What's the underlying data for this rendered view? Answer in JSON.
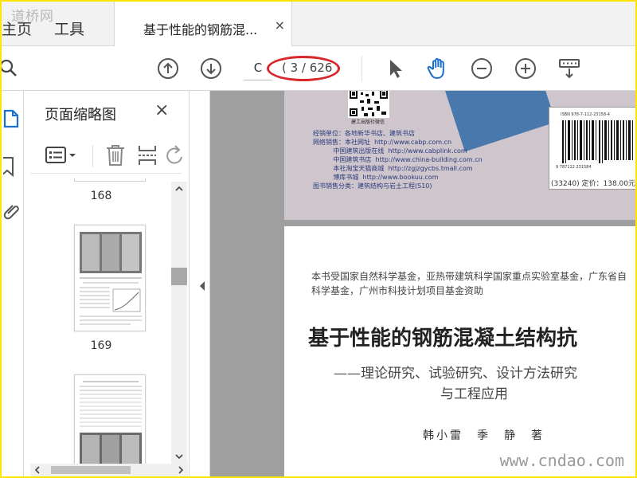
{
  "watermark_top": "道桥网",
  "watermark_bottom": "www.cndao.com",
  "tabs": {
    "home": "主页",
    "tools": "工具",
    "document": "基于性能的钢筋混...",
    "close": "×"
  },
  "toolbar": {
    "page_input": "C",
    "page_count": "( 3 / 626"
  },
  "panel": {
    "title": "页面缩略图",
    "close": "×",
    "thumbnails": [
      {
        "page": "168"
      },
      {
        "page": "169"
      }
    ]
  },
  "document": {
    "cover": {
      "qr_label": "建工出版社微信",
      "info_lines": [
        "经销单位：各地新华书店、建筑书店",
        "网络销售：本社网址  http://www.cabp.com.cn",
        "          中国建筑出版在线  http://www.cabplink.com",
        "          中国建筑书店  http://www.china-building.com.cn",
        "          本社淘宝天猫商城  http://zgjzgycbs.tmall.com",
        "          博库书城  http://www.bookuu.com",
        "图书销售分类：建筑结构与岩土工程(S10)"
      ],
      "isbn": "ISBN 978-7-112-23158-4",
      "isbn_digits": "9 787112 231584",
      "price": "(33240)  定价：138.00元"
    },
    "title_page": {
      "funding_line1": "本书受国家自然科学基金，亚热带建筑科学国家重点实验室基金，广东省自",
      "funding_line2": "科学基金，广州市科技计划项目基金资助",
      "title": "基于性能的钢筋混凝土结构抗",
      "subtitle1": "——理论研究、试验研究、设计方法研究",
      "subtitle2": "与工程应用",
      "authors": "韩小雷　季　静　著"
    }
  },
  "colors": {
    "frame": "#ffe600",
    "highlight_oval": "#d8262a",
    "hand_tool": "#1a6fd0"
  }
}
